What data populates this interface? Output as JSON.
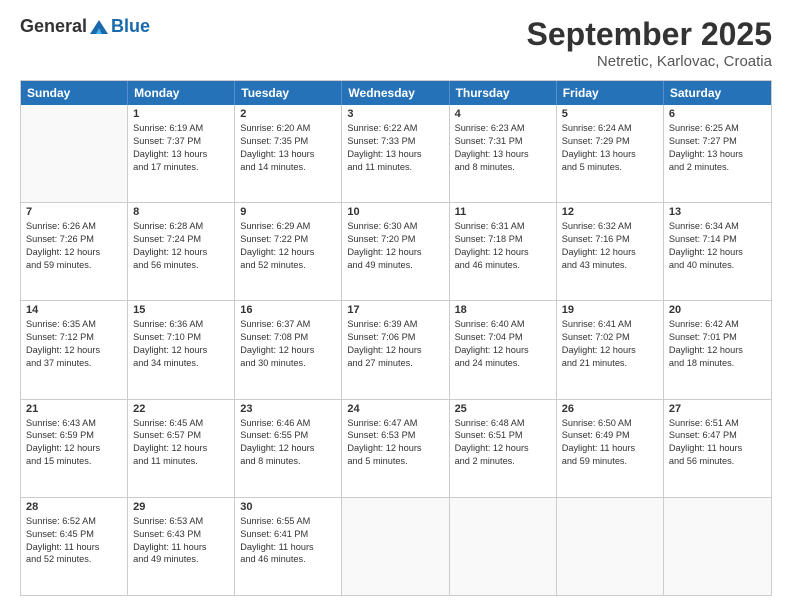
{
  "header": {
    "logo_general": "General",
    "logo_blue": "Blue",
    "month": "September 2025",
    "location": "Netretic, Karlovac, Croatia"
  },
  "days_of_week": [
    "Sunday",
    "Monday",
    "Tuesday",
    "Wednesday",
    "Thursday",
    "Friday",
    "Saturday"
  ],
  "weeks": [
    [
      {
        "day": "",
        "lines": []
      },
      {
        "day": "1",
        "lines": [
          "Sunrise: 6:19 AM",
          "Sunset: 7:37 PM",
          "Daylight: 13 hours",
          "and 17 minutes."
        ]
      },
      {
        "day": "2",
        "lines": [
          "Sunrise: 6:20 AM",
          "Sunset: 7:35 PM",
          "Daylight: 13 hours",
          "and 14 minutes."
        ]
      },
      {
        "day": "3",
        "lines": [
          "Sunrise: 6:22 AM",
          "Sunset: 7:33 PM",
          "Daylight: 13 hours",
          "and 11 minutes."
        ]
      },
      {
        "day": "4",
        "lines": [
          "Sunrise: 6:23 AM",
          "Sunset: 7:31 PM",
          "Daylight: 13 hours",
          "and 8 minutes."
        ]
      },
      {
        "day": "5",
        "lines": [
          "Sunrise: 6:24 AM",
          "Sunset: 7:29 PM",
          "Daylight: 13 hours",
          "and 5 minutes."
        ]
      },
      {
        "day": "6",
        "lines": [
          "Sunrise: 6:25 AM",
          "Sunset: 7:27 PM",
          "Daylight: 13 hours",
          "and 2 minutes."
        ]
      }
    ],
    [
      {
        "day": "7",
        "lines": [
          "Sunrise: 6:26 AM",
          "Sunset: 7:26 PM",
          "Daylight: 12 hours",
          "and 59 minutes."
        ]
      },
      {
        "day": "8",
        "lines": [
          "Sunrise: 6:28 AM",
          "Sunset: 7:24 PM",
          "Daylight: 12 hours",
          "and 56 minutes."
        ]
      },
      {
        "day": "9",
        "lines": [
          "Sunrise: 6:29 AM",
          "Sunset: 7:22 PM",
          "Daylight: 12 hours",
          "and 52 minutes."
        ]
      },
      {
        "day": "10",
        "lines": [
          "Sunrise: 6:30 AM",
          "Sunset: 7:20 PM",
          "Daylight: 12 hours",
          "and 49 minutes."
        ]
      },
      {
        "day": "11",
        "lines": [
          "Sunrise: 6:31 AM",
          "Sunset: 7:18 PM",
          "Daylight: 12 hours",
          "and 46 minutes."
        ]
      },
      {
        "day": "12",
        "lines": [
          "Sunrise: 6:32 AM",
          "Sunset: 7:16 PM",
          "Daylight: 12 hours",
          "and 43 minutes."
        ]
      },
      {
        "day": "13",
        "lines": [
          "Sunrise: 6:34 AM",
          "Sunset: 7:14 PM",
          "Daylight: 12 hours",
          "and 40 minutes."
        ]
      }
    ],
    [
      {
        "day": "14",
        "lines": [
          "Sunrise: 6:35 AM",
          "Sunset: 7:12 PM",
          "Daylight: 12 hours",
          "and 37 minutes."
        ]
      },
      {
        "day": "15",
        "lines": [
          "Sunrise: 6:36 AM",
          "Sunset: 7:10 PM",
          "Daylight: 12 hours",
          "and 34 minutes."
        ]
      },
      {
        "day": "16",
        "lines": [
          "Sunrise: 6:37 AM",
          "Sunset: 7:08 PM",
          "Daylight: 12 hours",
          "and 30 minutes."
        ]
      },
      {
        "day": "17",
        "lines": [
          "Sunrise: 6:39 AM",
          "Sunset: 7:06 PM",
          "Daylight: 12 hours",
          "and 27 minutes."
        ]
      },
      {
        "day": "18",
        "lines": [
          "Sunrise: 6:40 AM",
          "Sunset: 7:04 PM",
          "Daylight: 12 hours",
          "and 24 minutes."
        ]
      },
      {
        "day": "19",
        "lines": [
          "Sunrise: 6:41 AM",
          "Sunset: 7:02 PM",
          "Daylight: 12 hours",
          "and 21 minutes."
        ]
      },
      {
        "day": "20",
        "lines": [
          "Sunrise: 6:42 AM",
          "Sunset: 7:01 PM",
          "Daylight: 12 hours",
          "and 18 minutes."
        ]
      }
    ],
    [
      {
        "day": "21",
        "lines": [
          "Sunrise: 6:43 AM",
          "Sunset: 6:59 PM",
          "Daylight: 12 hours",
          "and 15 minutes."
        ]
      },
      {
        "day": "22",
        "lines": [
          "Sunrise: 6:45 AM",
          "Sunset: 6:57 PM",
          "Daylight: 12 hours",
          "and 11 minutes."
        ]
      },
      {
        "day": "23",
        "lines": [
          "Sunrise: 6:46 AM",
          "Sunset: 6:55 PM",
          "Daylight: 12 hours",
          "and 8 minutes."
        ]
      },
      {
        "day": "24",
        "lines": [
          "Sunrise: 6:47 AM",
          "Sunset: 6:53 PM",
          "Daylight: 12 hours",
          "and 5 minutes."
        ]
      },
      {
        "day": "25",
        "lines": [
          "Sunrise: 6:48 AM",
          "Sunset: 6:51 PM",
          "Daylight: 12 hours",
          "and 2 minutes."
        ]
      },
      {
        "day": "26",
        "lines": [
          "Sunrise: 6:50 AM",
          "Sunset: 6:49 PM",
          "Daylight: 11 hours",
          "and 59 minutes."
        ]
      },
      {
        "day": "27",
        "lines": [
          "Sunrise: 6:51 AM",
          "Sunset: 6:47 PM",
          "Daylight: 11 hours",
          "and 56 minutes."
        ]
      }
    ],
    [
      {
        "day": "28",
        "lines": [
          "Sunrise: 6:52 AM",
          "Sunset: 6:45 PM",
          "Daylight: 11 hours",
          "and 52 minutes."
        ]
      },
      {
        "day": "29",
        "lines": [
          "Sunrise: 6:53 AM",
          "Sunset: 6:43 PM",
          "Daylight: 11 hours",
          "and 49 minutes."
        ]
      },
      {
        "day": "30",
        "lines": [
          "Sunrise: 6:55 AM",
          "Sunset: 6:41 PM",
          "Daylight: 11 hours",
          "and 46 minutes."
        ]
      },
      {
        "day": "",
        "lines": []
      },
      {
        "day": "",
        "lines": []
      },
      {
        "day": "",
        "lines": []
      },
      {
        "day": "",
        "lines": []
      }
    ]
  ]
}
